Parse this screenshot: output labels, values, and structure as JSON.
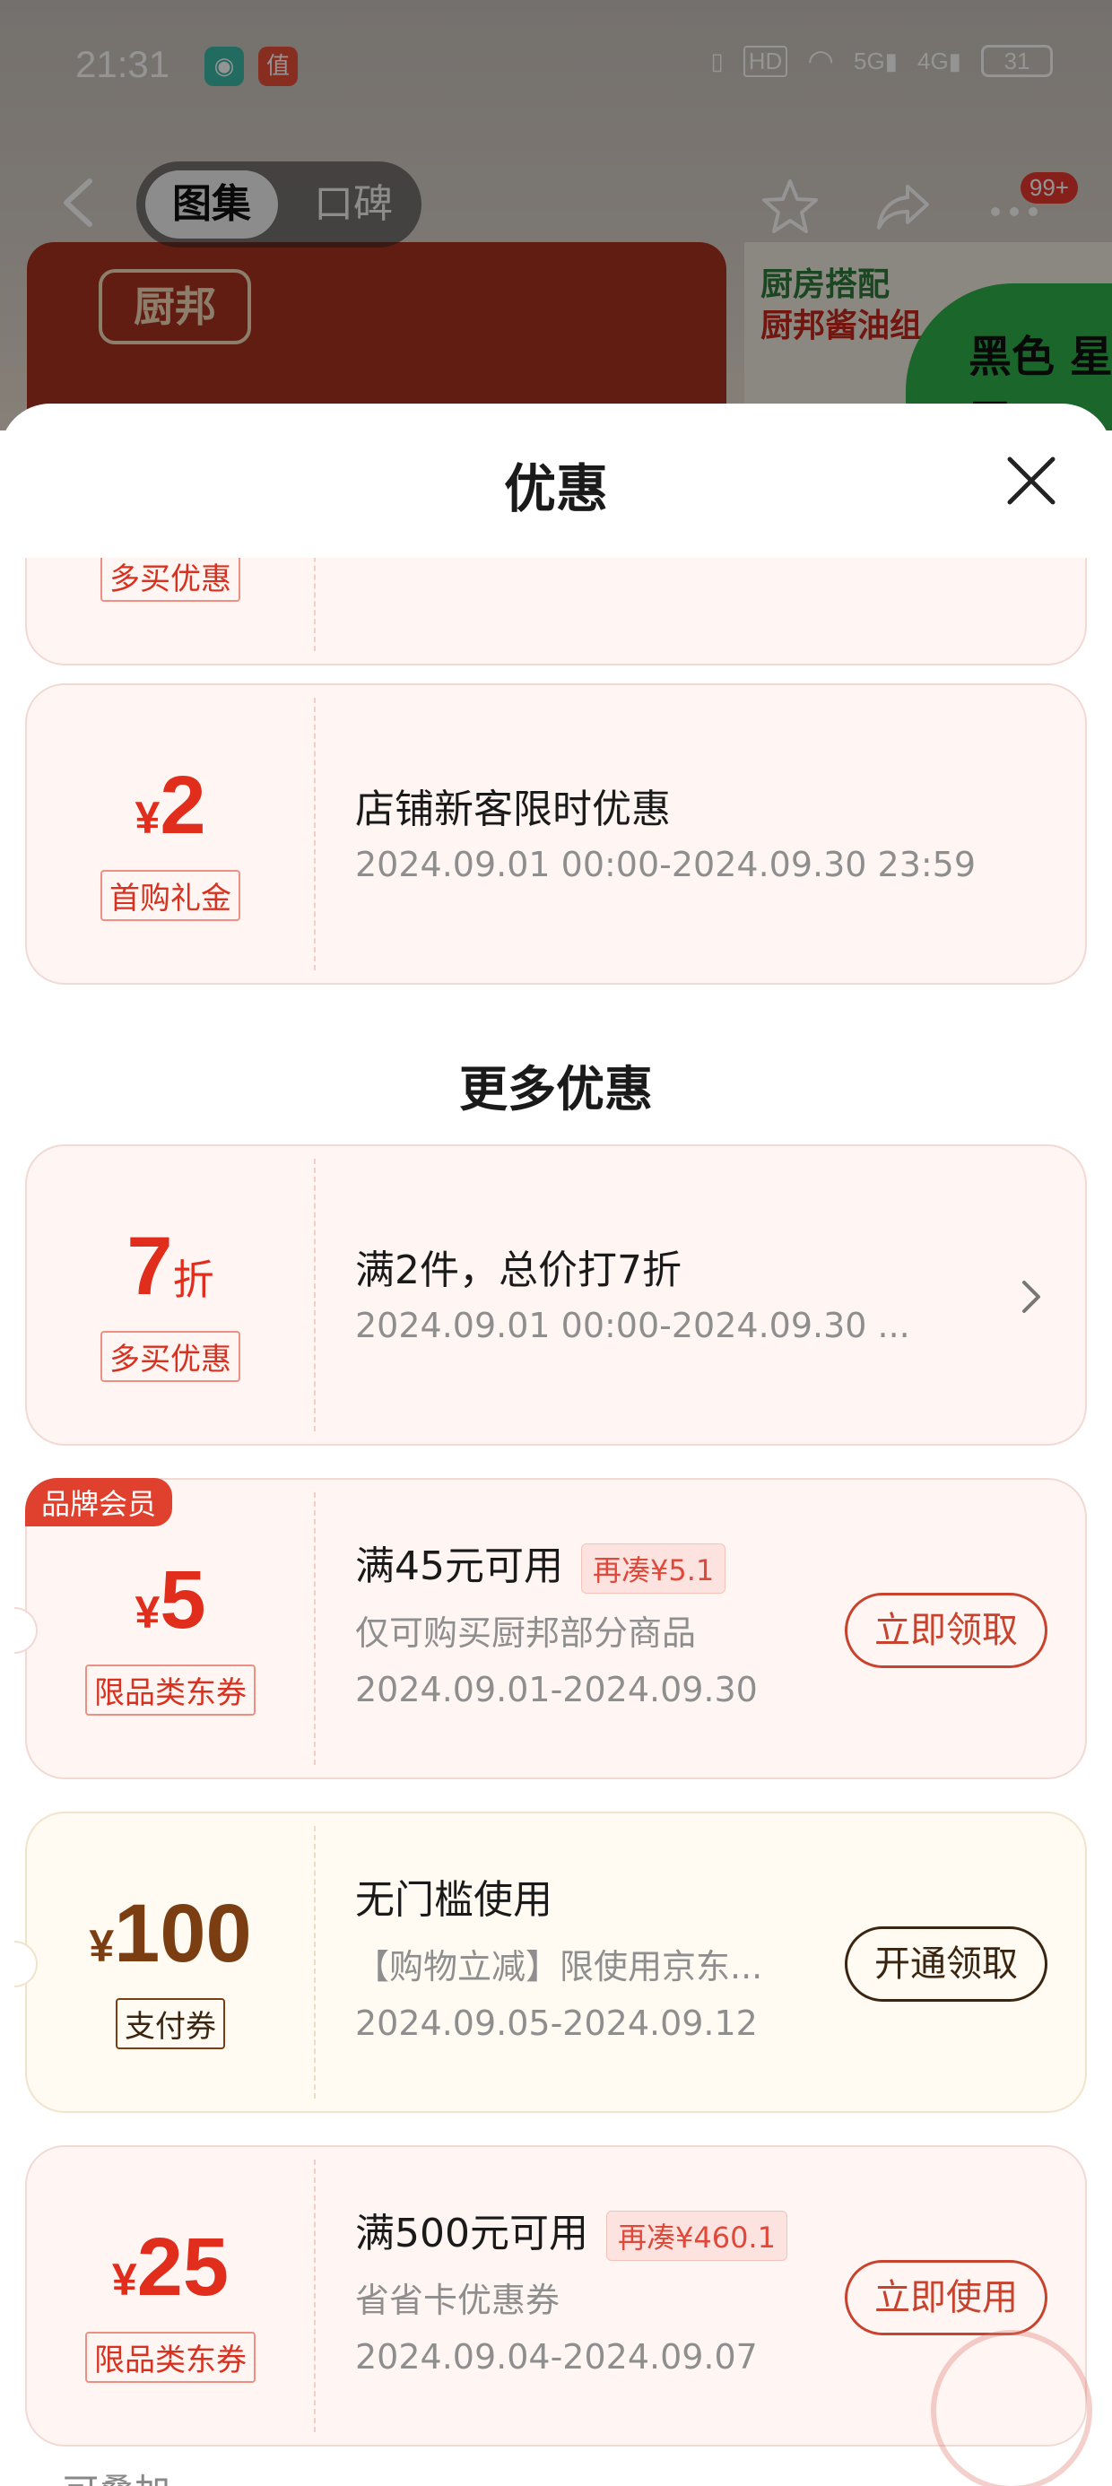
{
  "status_bar": {
    "time": "21:31",
    "battery": "31",
    "icons": [
      "vibrate-icon",
      "hd-icon",
      "wifi-icon",
      "5g-signal-icon",
      "4g-signal-icon",
      "battery-icon"
    ]
  },
  "background_app": {
    "tabs": [
      "图集",
      "口碑"
    ],
    "cart_badge": "99+",
    "brand_logo": "厨邦",
    "promo_line_1": "厨房搭配",
    "promo_line_2": "厨邦酱油组",
    "promo_green": "黑色 星期五"
  },
  "sheet": {
    "title": "优惠",
    "partial_coupon_tag": "多买优惠",
    "coupons_top": [
      {
        "currency": "¥",
        "amount": "2",
        "tag": "首购礼金",
        "title": "店铺新客限时优惠",
        "period": "2024.09.01 00:00-2024.09.30 23:59"
      }
    ],
    "more_title": "更多优惠",
    "coupons_more": [
      {
        "amount": "7",
        "suffix": "折",
        "tag": "多买优惠",
        "title": "满2件，总价打7折",
        "period": "2024.09.01 00:00-2024.09.30 ..."
      },
      {
        "badge": "品牌会员",
        "currency": "¥",
        "amount": "5",
        "tag": "限品类东券",
        "title": "满45元可用",
        "diff": "再凑¥5.1",
        "scope": "仅可购买厨邦部分商品",
        "period": "2024.09.01-2024.09.30",
        "action": "立即领取"
      },
      {
        "currency": "¥",
        "amount": "100",
        "tag": "支付券",
        "title": "无门槛使用",
        "scope": "【购物立减】限使用京东...",
        "period": "2024.09.05-2024.09.12",
        "action": "开通领取"
      },
      {
        "currency": "¥",
        "amount": "25",
        "tag": "限品类东券",
        "title": "满500元可用",
        "diff": "再凑¥460.1",
        "scope": "省省卡优惠券",
        "period": "2024.09.04-2024.09.07",
        "action": "立即使用"
      }
    ],
    "stackable_hint": "可叠加"
  },
  "colors": {
    "accent_red": "#e02d1c",
    "coupon_bg": "#fff6f4",
    "gold_text": "#7a3e12"
  }
}
